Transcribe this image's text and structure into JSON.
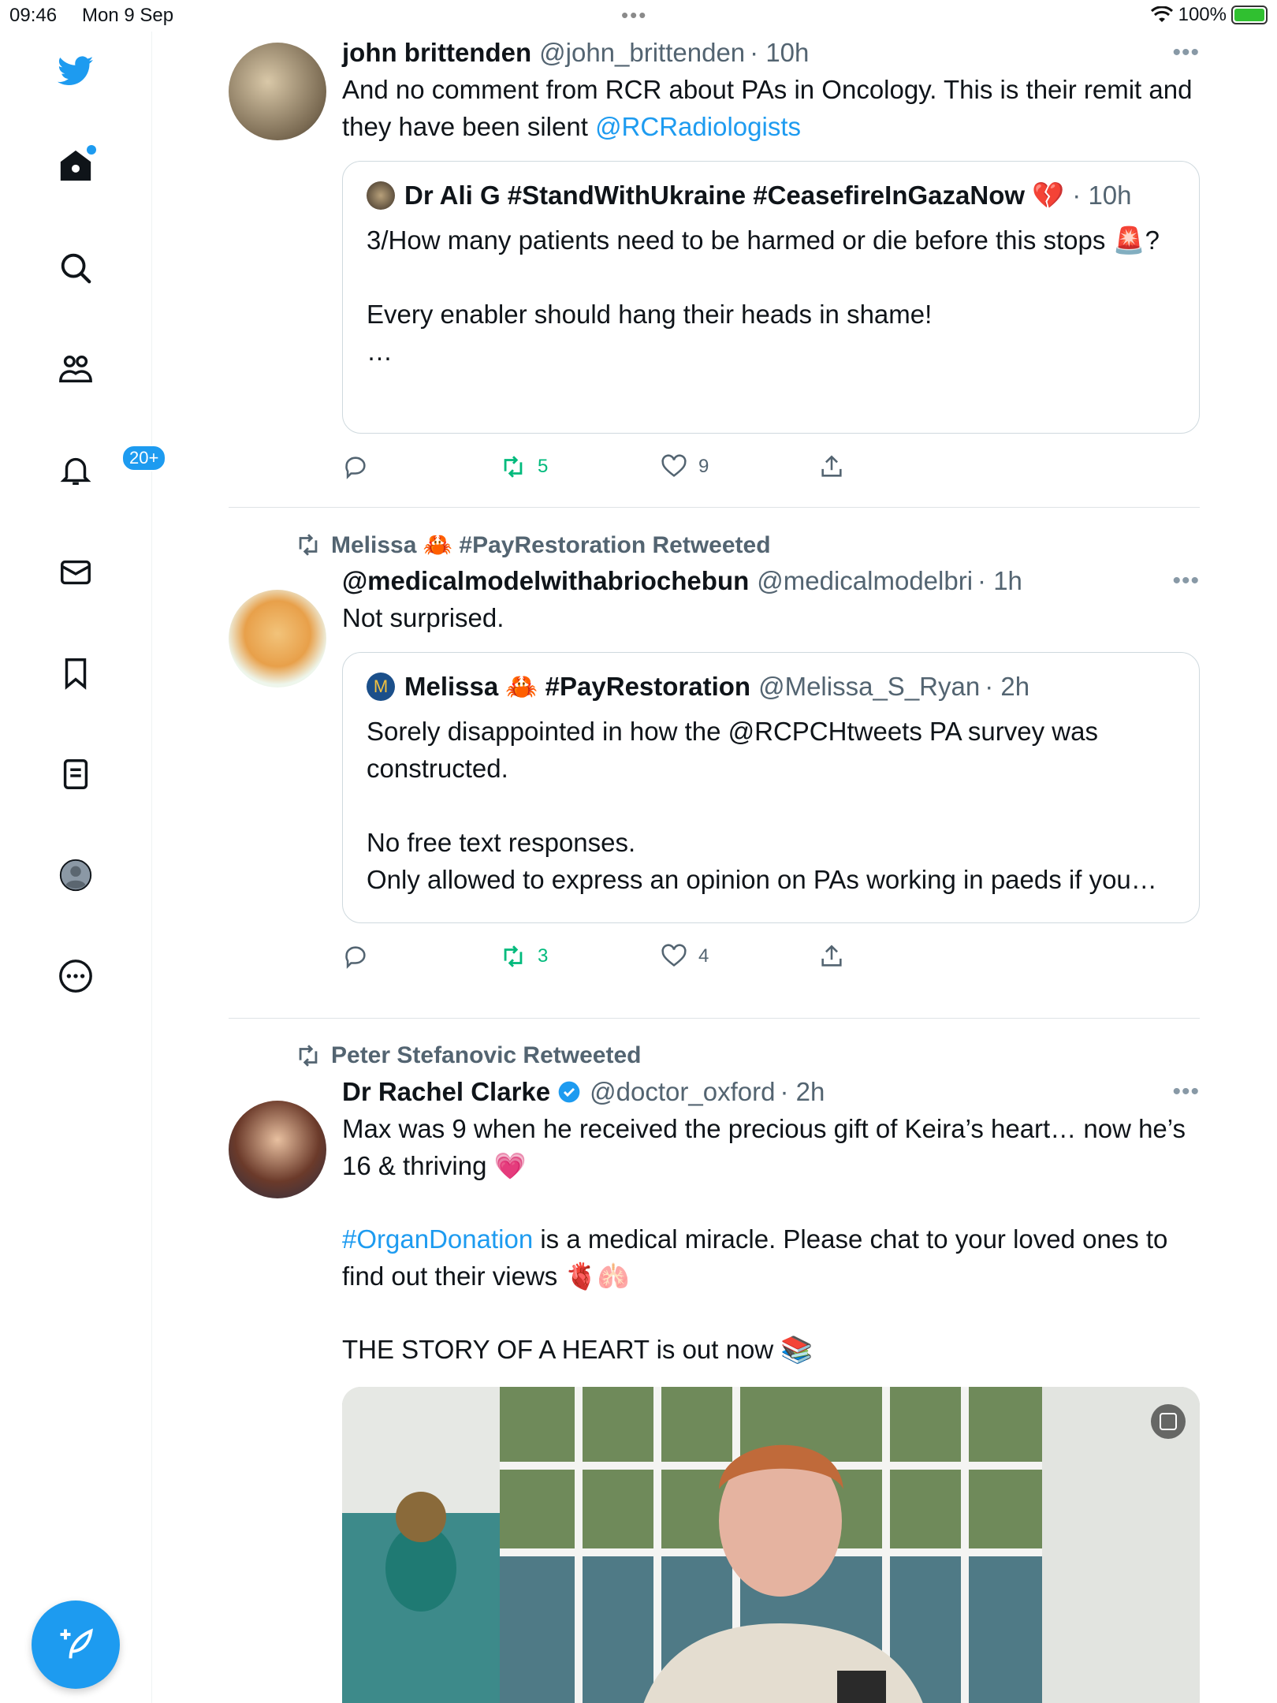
{
  "status": {
    "time": "09:46",
    "date": "Mon 9 Sep",
    "battery": "100%"
  },
  "sidebar": {
    "notifications_badge": "20+"
  },
  "tweets": [
    {
      "name": "john brittenden",
      "handle": "@john_brittenden",
      "time": "· 10h",
      "text": "And no comment from RCR about PAs in Oncology. This is their remit and they have been silent ",
      "mention": "@RCRadiologists",
      "quote": {
        "name": "Dr Ali G #StandWithUkraine #CeasefireInGazaNow 💔",
        "time": "· 10h",
        "text": "3/How many patients need to be harmed or die before this stops 🚨?\n\nEvery enabler should hang their heads in shame!\n…"
      },
      "retweets": "5",
      "likes": "9"
    },
    {
      "retweeted_by": "Melissa 🦀 #PayRestoration Retweeted",
      "name": "@medicalmodelwithabriochebun",
      "handle": "@medicalmodelbri",
      "time": "· 1h",
      "text": "Not surprised.",
      "quote": {
        "name": "Melissa 🦀 #PayRestoration",
        "handle": "@Melissa_S_Ryan",
        "time": "· 2h",
        "text": "Sorely disappointed in how the @RCPCHtweets PA survey was constructed.\n\nNo free text responses.\nOnly allowed to express an opinion on PAs working in paeds if you…"
      },
      "retweets": "3",
      "likes": "4"
    },
    {
      "retweeted_by": "Peter Stefanovic Retweeted",
      "name": "Dr Rachel Clarke",
      "handle": "@doctor_oxford",
      "time": "· 2h",
      "text1": "Max was 9 when he received the precious gift of Keira’s heart… now he’s 16 & thriving 💗",
      "hashtag": "#OrganDonation",
      "text2": " is a medical miracle. Please chat to your loved ones to find out their views 🫀🫁",
      "text3": "THE STORY OF A HEART is out now 📚"
    }
  ],
  "colors": {
    "accent": "#1d9bf0",
    "retweet": "#00ba7c",
    "muted": "#536471"
  }
}
